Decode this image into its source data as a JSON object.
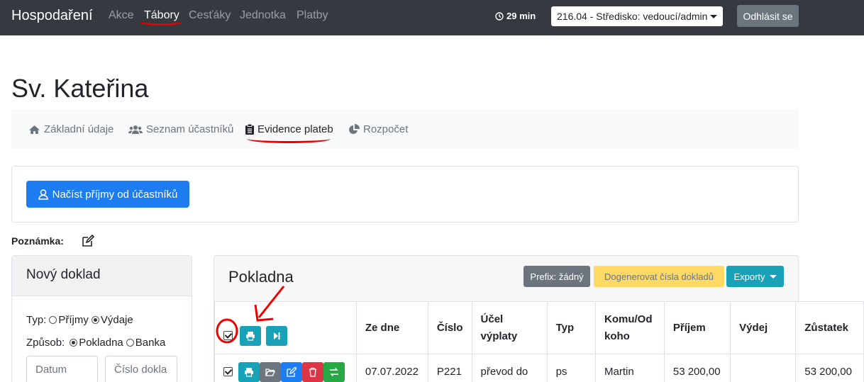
{
  "navbar": {
    "brand": "Hospodaření",
    "links": [
      "Akce",
      "Tábory",
      "Cesťáky",
      "Jednotka",
      "Platby"
    ],
    "timer": "29 min",
    "unit_selected": "216.04 - Středisko: vedoucí/admin",
    "logout_label": "Odhlásit se"
  },
  "page": {
    "title": "Sv. Kateřina"
  },
  "tabs": [
    "Základní údaje",
    "Seznam účastníků",
    "Evidence plateb",
    "Rozpočet"
  ],
  "import_button": "Načíst příjmy od účastníků",
  "note_label": "Poznámka:",
  "new_doc": {
    "title": "Nový doklad",
    "type_label": "Typ:",
    "type_income": "Příjmy",
    "type_expense": "Výdaje",
    "method_label": "Způsob:",
    "method_cash": "Pokladna",
    "method_bank": "Banka",
    "date_placeholder": "Datum",
    "number_placeholder": "Číslo dokla"
  },
  "cash": {
    "title": "Pokladna",
    "prefix_label": "Prefix: žádný",
    "generate_label": "Dogenerovat čísla dokladů",
    "exports_label": "Exporty",
    "columns": [
      "Ze dne",
      "Číslo",
      "Účel výplaty",
      "Typ",
      "Komu/Od koho",
      "Příjem",
      "Výdej",
      "Zůstatek"
    ],
    "row": {
      "date": "07.07.2022",
      "number": "P221",
      "purpose": "převod do",
      "type": "ps",
      "who": "Martin",
      "income": "53 200,00",
      "expense": "",
      "balance": "53 200,00"
    }
  },
  "colors": {
    "navbar": "#343a40",
    "primary": "#1c7cf0",
    "info": "#17a2b8",
    "warning": "#ffd966",
    "secondary": "#6c757d",
    "danger": "#dc3545",
    "success": "#28a745",
    "annotation": "#e00000"
  }
}
